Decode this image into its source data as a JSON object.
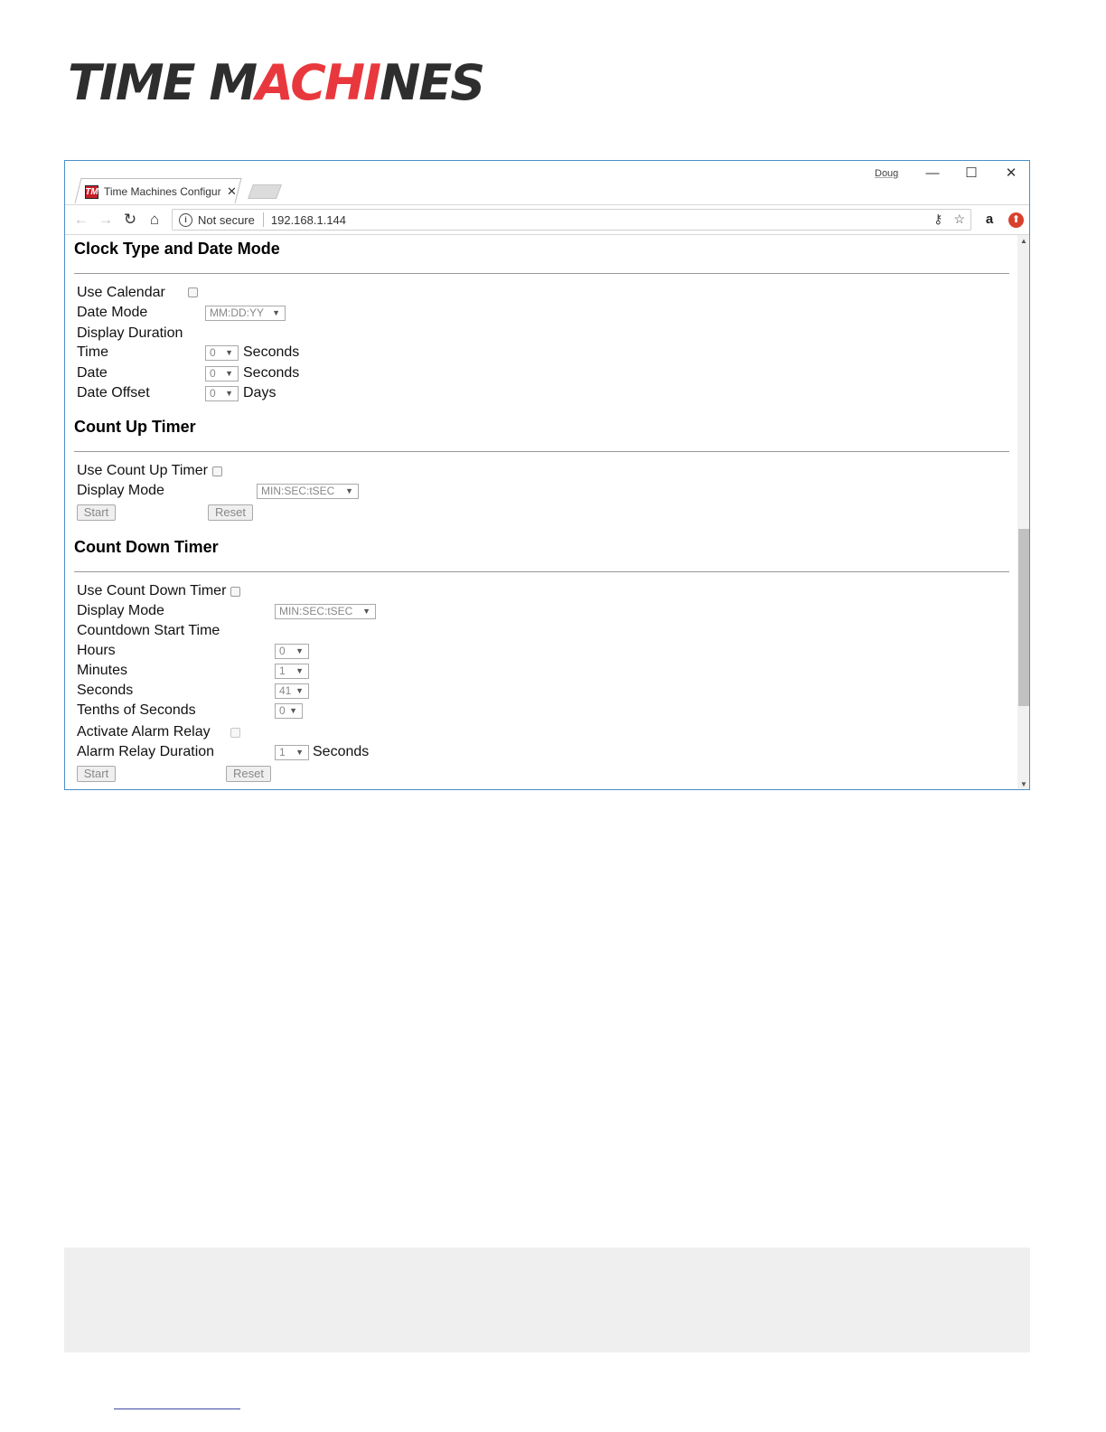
{
  "logo": {
    "part1": "TIME M",
    "part2": "ACHI",
    "part3": "NES"
  },
  "browser": {
    "tab_icon_text": "TM",
    "tab_title": "Time Machines Configura",
    "tab_close": "✕",
    "profile": "Doug",
    "win_min": "—",
    "win_max": "☐",
    "win_close": "✕",
    "back": "←",
    "forward": "→",
    "reload": "↻",
    "home": "⌂",
    "security_icon": "i",
    "security_text": "Not secure",
    "url": "192.168.1.144",
    "key_icon": "⚷",
    "star_icon": "☆",
    "ext_amazon": "a",
    "ext_red": "⬆"
  },
  "clock_section": {
    "title": "Clock Type and Date Mode",
    "use_calendar_label": "Use Calendar",
    "date_mode_label": "Date Mode",
    "date_mode_value": "MM:DD:YY",
    "display_duration_label": "Display Duration",
    "time_label": "Time",
    "time_value": "0",
    "time_unit": "Seconds",
    "date_label": "Date",
    "date_value": "0",
    "date_unit": "Seconds",
    "date_offset_label": "Date Offset",
    "date_offset_value": "0",
    "date_offset_unit": "Days"
  },
  "count_up": {
    "title": "Count Up Timer",
    "use_label": "Use Count Up Timer",
    "display_mode_label": "Display Mode",
    "display_mode_value": "MIN:SEC:tSEC",
    "start_label": "Start",
    "reset_label": "Reset"
  },
  "count_down": {
    "title": "Count Down Timer",
    "use_label": "Use Count Down Timer",
    "display_mode_label": "Display Mode",
    "display_mode_value": "MIN:SEC:tSEC",
    "start_time_label": "Countdown Start Time",
    "hours_label": "Hours",
    "hours_value": "0",
    "minutes_label": "Minutes",
    "minutes_value": "1",
    "seconds_label": "Seconds",
    "seconds_value": "41",
    "tenths_label": "Tenths of Seconds",
    "tenths_value": "0",
    "alarm_label": "Activate Alarm Relay",
    "alarm_duration_label": "Alarm Relay Duration",
    "alarm_duration_value": "1",
    "alarm_duration_unit": "Seconds",
    "start_label": "Start",
    "reset_label": "Reset"
  },
  "colors": {
    "accent_red": "#e8383d",
    "logo_dark": "#2e2e2e",
    "window_border": "#4a8fc7"
  }
}
